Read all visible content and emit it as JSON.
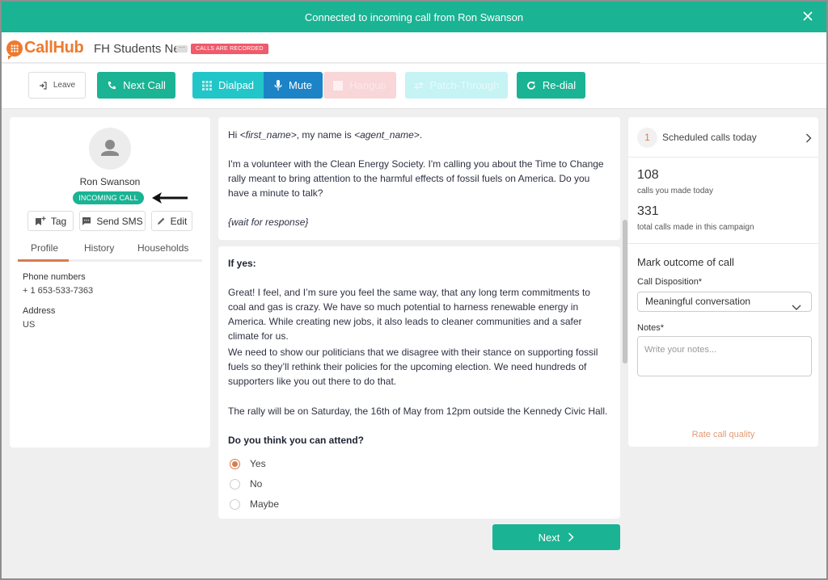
{
  "banner": {
    "message": "Connected to incoming call from Ron Swanson",
    "close_icon": "close-icon"
  },
  "header": {
    "logo_text": "CallHub",
    "campaign_name": "FH Students Nea",
    "more_label": "···",
    "recorded_badge": "CALLS ARE RECORDED"
  },
  "toolbar": {
    "leave_label": "Leave",
    "next_call_label": "Next Call",
    "dialpad_label": "Dialpad",
    "mute_label": "Mute",
    "hangup_label": "Hangup",
    "patch_label": "Patch-Through",
    "redial_label": "Re-dial"
  },
  "contact": {
    "name": "Ron Swanson",
    "status_badge": "INCOMING CALL",
    "actions": {
      "tag": "Tag",
      "sms": "Send SMS",
      "edit": "Edit"
    },
    "tabs": [
      "Profile",
      "History",
      "Households"
    ],
    "active_tab": "Profile",
    "fields": [
      {
        "label": "Phone numbers",
        "value": "+ 1 653-533-7363"
      },
      {
        "label": "Address",
        "value": "US"
      }
    ]
  },
  "script": {
    "greeting_hi": "Hi ",
    "greeting_first_name": "<first_name>",
    "greeting_mid": ", my name is ",
    "greeting_agent_name": "<agent_name>",
    "greeting_end": ".",
    "intro": "I'm a volunteer with the Clean Energy Society. I'm calling you about the Time to Change rally meant to bring attention to the harmful effects of fossil fuels on America. Do you have a minute to talk?",
    "wait": "{wait for response}",
    "if_yes": "If yes:",
    "para1": "Great! I feel, and I’m sure you feel the same way, that any long term commitments to coal and gas is crazy. We have so much potential to harness renewable energy in America. While creating new jobs, it also leads to cleaner communities and a safer climate for us.",
    "para2": "We need to show our politicians that we disagree with their stance on supporting fossil fuels so they’ll rethink their policies for the upcoming election. We need hundreds of supporters like you out there to do that.",
    "para3": "The rally will be on Saturday, the 16th of May from 12pm outside the Kennedy Civic Hall.",
    "question": "Do you think you can attend?",
    "options": [
      "Yes",
      "No",
      "Maybe"
    ],
    "selected": "Yes",
    "next_label": "Next"
  },
  "stats": {
    "scheduled_count": "1",
    "scheduled_label": "Scheduled calls today",
    "calls_today": "108",
    "calls_today_label": "calls you made today",
    "total_calls": "331",
    "total_calls_label": "total calls made in this campaign"
  },
  "outcome": {
    "title": "Mark outcome of call",
    "disposition_label": "Call Disposition*",
    "disposition_value": "Meaningful conversation",
    "notes_label": "Notes*",
    "notes_placeholder": "Write your notes...",
    "rate_link": "Rate call quality"
  },
  "colors": {
    "brand_orange": "#ee7a2f",
    "primary_green": "#1ab394",
    "mute_blue": "#1c84c6",
    "dialpad_teal": "#23c6c8",
    "recorded_red": "#f05a6b",
    "accent_orange": "#d97b4f"
  }
}
